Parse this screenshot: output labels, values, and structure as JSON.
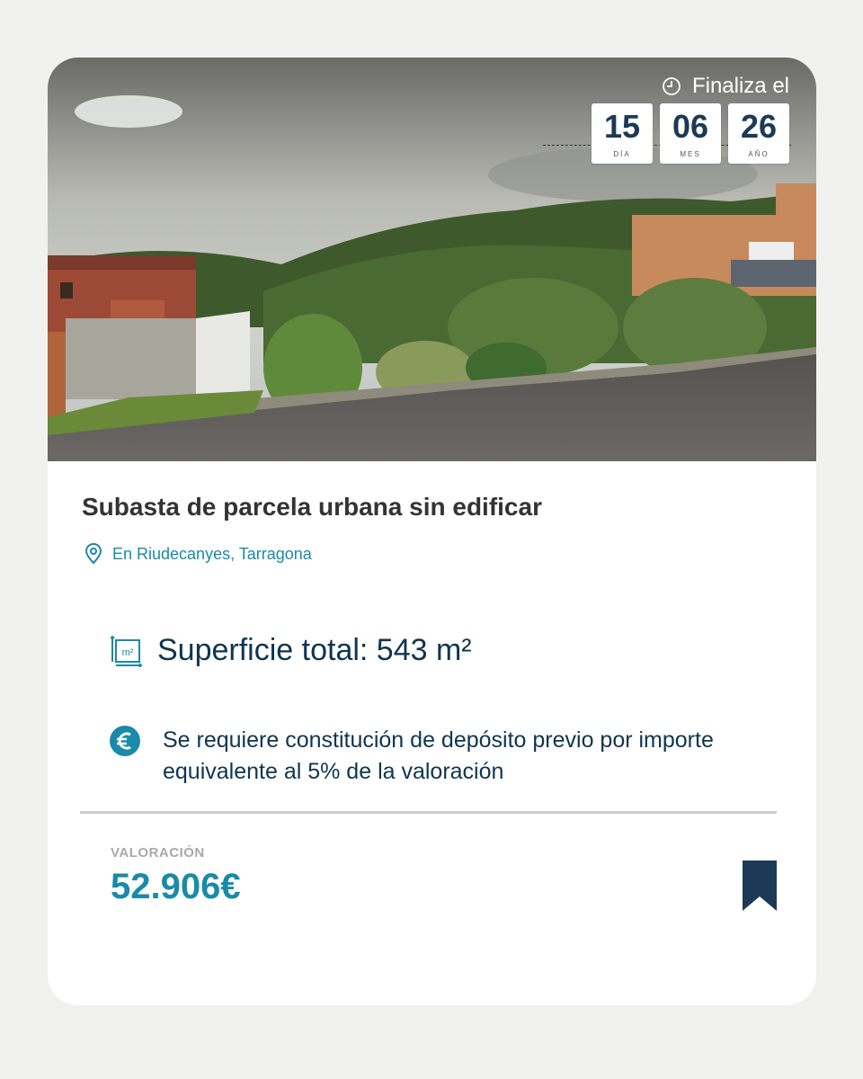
{
  "header": {
    "ends_label": "Finaliza el",
    "day": "15",
    "day_label": "DÍA",
    "month": "06",
    "month_label": "MES",
    "year": "26",
    "year_label": "AÑO"
  },
  "listing": {
    "title": "Subasta de parcela urbana sin edificar",
    "location": "En Riudecanyes, Tarragona",
    "surface_icon_text": "m²",
    "surface": "Superficie total: 543 m²",
    "deposit_line1": "Se requiere constitución de depósito previo por importe",
    "deposit_line2": "equivalente al 5% de la valoración",
    "valuation_label": "VALORACIÓN",
    "valuation_amount": "52.906€"
  },
  "icons": {
    "clock": "clock-icon",
    "location": "location-pin-icon",
    "surface": "area-m2-icon",
    "euro": "euro-icon",
    "bookmark": "bookmark-icon"
  },
  "colors": {
    "accent": "#1a8aa8",
    "dark": "#0f3550",
    "bookmark": "#1c3a55",
    "background": "#f1f1ef"
  }
}
